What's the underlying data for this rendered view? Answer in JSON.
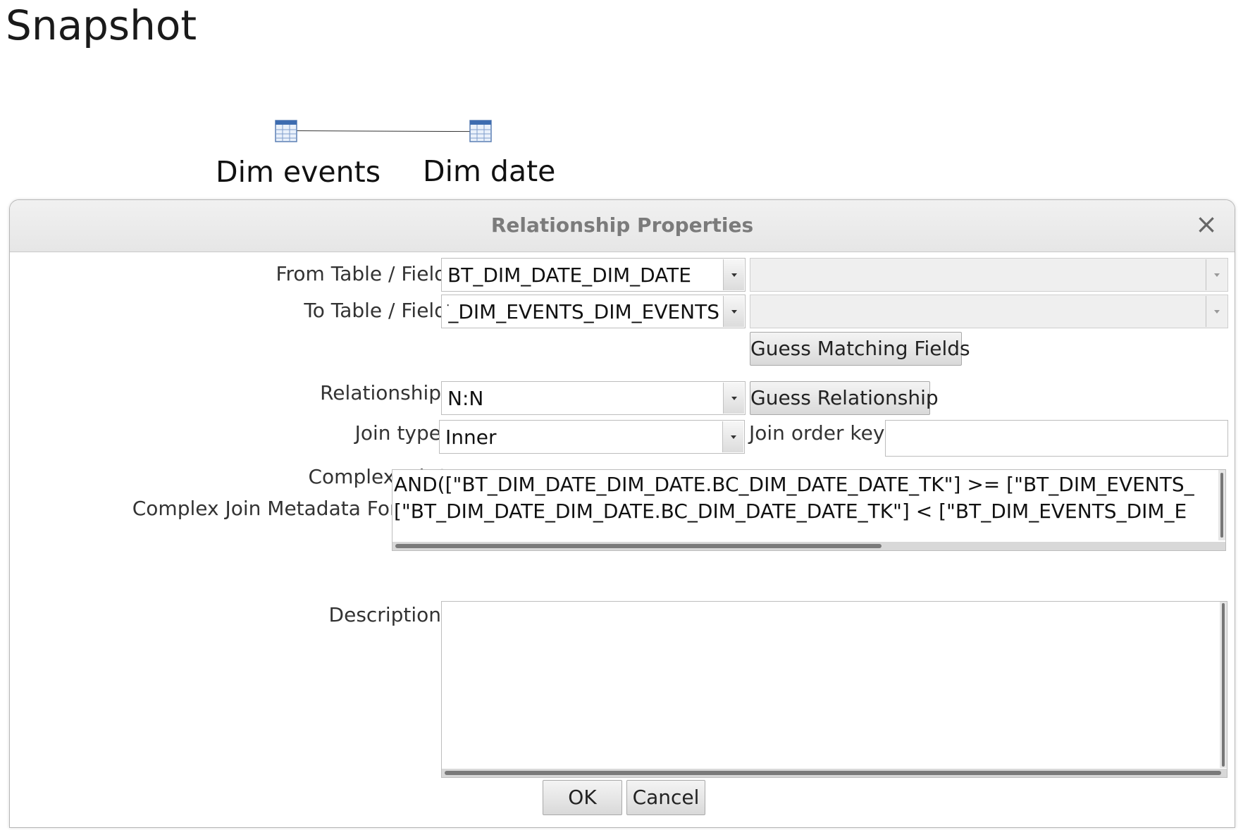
{
  "page": {
    "title": "Snapshot"
  },
  "diagram": {
    "nodes": [
      {
        "label": "Dim events",
        "icon": "table-icon"
      },
      {
        "label": "Dim date",
        "icon": "table-icon"
      }
    ]
  },
  "dialog": {
    "title": "Relationship Properties",
    "close_label": "×",
    "from": {
      "label": "From Table / Field",
      "table": "BT_DIM_DATE_DIM_DATE",
      "field": ""
    },
    "to": {
      "label": "To Table / Field",
      "table": "BT_DIM_EVENTS_DIM_EVENTS",
      "field": ""
    },
    "guess_fields_label": "Guess Matching Fields",
    "relationship": {
      "label": "Relationship",
      "value": "N:N"
    },
    "guess_relationship_label": "Guess Relationship",
    "join_type": {
      "label": "Join type",
      "value": "Inner"
    },
    "join_order_key": {
      "label": "Join order key",
      "value": ""
    },
    "complex_join": {
      "label": "Complex Join?",
      "checked": true
    },
    "formula": {
      "label": "Complex Join Metadata Formula",
      "line1": "AND([\"BT_DIM_DATE_DIM_DATE.BC_DIM_DATE_DATE_TK\"] >= [\"BT_DIM_EVENTS_",
      "line2": "[\"BT_DIM_DATE_DIM_DATE.BC_DIM_DATE_DATE_TK\"] < [\"BT_DIM_EVENTS_DIM_E"
    },
    "description": {
      "label": "Description",
      "value": ""
    },
    "ok_label": "OK",
    "cancel_label": "Cancel"
  }
}
